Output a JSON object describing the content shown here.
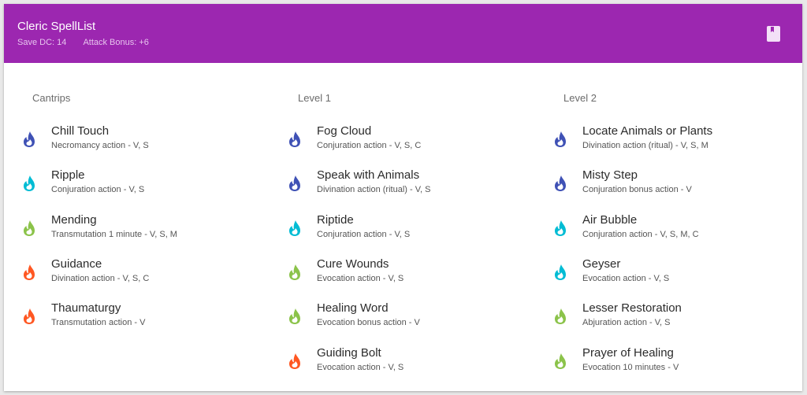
{
  "header": {
    "title": "Cleric SpellList",
    "save_dc": "Save DC: 14",
    "attack_bonus": "Attack Bonus: +6",
    "icon": "book-icon"
  },
  "colors": {
    "header_bg": "#9c27b0",
    "school_colors": {
      "indigo": "#3f51b5",
      "cyan": "#00bcd4",
      "green": "#8bc34a",
      "orange": "#ff5722"
    }
  },
  "columns": [
    {
      "heading": "Cantrips",
      "spells": [
        {
          "name": "Chill Touch",
          "desc": "Necromancy action - V, S",
          "icon": "flame-icon",
          "color": "#3f51b5"
        },
        {
          "name": "Ripple",
          "desc": "Conjuration action - V, S",
          "icon": "flame-icon",
          "color": "#00bcd4"
        },
        {
          "name": "Mending",
          "desc": "Transmutation 1 minute - V, S, M",
          "icon": "flame-icon",
          "color": "#8bc34a"
        },
        {
          "name": "Guidance",
          "desc": "Divination action - V, S, C",
          "icon": "flame-icon",
          "color": "#ff5722"
        },
        {
          "name": "Thaumaturgy",
          "desc": "Transmutation action - V",
          "icon": "flame-icon",
          "color": "#ff5722"
        }
      ]
    },
    {
      "heading": "Level 1",
      "spells": [
        {
          "name": "Fog Cloud",
          "desc": "Conjuration action - V, S, C",
          "icon": "flame-icon",
          "color": "#3f51b5"
        },
        {
          "name": "Speak with Animals",
          "desc": "Divination action (ritual) - V, S",
          "icon": "flame-icon",
          "color": "#3f51b5"
        },
        {
          "name": "Riptide",
          "desc": "Conjuration action - V, S",
          "icon": "flame-icon",
          "color": "#00bcd4"
        },
        {
          "name": "Cure Wounds",
          "desc": "Evocation action - V, S",
          "icon": "flame-icon",
          "color": "#8bc34a"
        },
        {
          "name": "Healing Word",
          "desc": "Evocation bonus action - V",
          "icon": "flame-icon",
          "color": "#8bc34a"
        },
        {
          "name": "Guiding Bolt",
          "desc": "Evocation action - V, S",
          "icon": "flame-icon",
          "color": "#ff5722"
        }
      ]
    },
    {
      "heading": "Level 2",
      "spells": [
        {
          "name": "Locate Animals or Plants",
          "desc": "Divination action (ritual) - V, S, M",
          "icon": "flame-icon",
          "color": "#3f51b5"
        },
        {
          "name": "Misty Step",
          "desc": "Conjuration bonus action - V",
          "icon": "flame-icon",
          "color": "#3f51b5"
        },
        {
          "name": "Air Bubble",
          "desc": "Conjuration action - V, S, M, C",
          "icon": "flame-icon",
          "color": "#00bcd4"
        },
        {
          "name": "Geyser",
          "desc": "Evocation action - V, S",
          "icon": "flame-icon",
          "color": "#00bcd4"
        },
        {
          "name": "Lesser Restoration",
          "desc": "Abjuration action - V, S",
          "icon": "flame-icon",
          "color": "#8bc34a"
        },
        {
          "name": "Prayer of Healing",
          "desc": "Evocation 10 minutes - V",
          "icon": "flame-icon",
          "color": "#8bc34a"
        }
      ]
    }
  ]
}
